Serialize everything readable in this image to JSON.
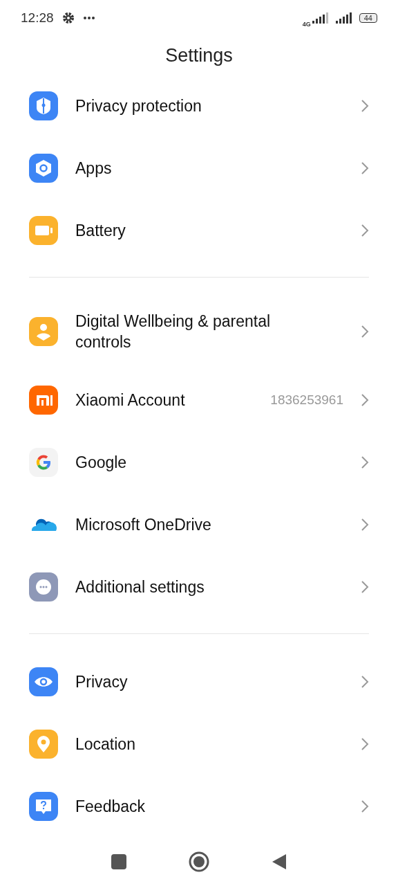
{
  "status_bar": {
    "time": "12:28",
    "network": "4G",
    "battery": "44"
  },
  "title": "Settings",
  "sections": [
    {
      "items": [
        {
          "kind": "shield",
          "label": "Privacy protection"
        },
        {
          "kind": "apps",
          "label": "Apps"
        },
        {
          "kind": "battery",
          "label": "Battery"
        }
      ]
    },
    {
      "items": [
        {
          "kind": "wellbeing",
          "label": "Digital Wellbeing & parental controls"
        },
        {
          "kind": "mi",
          "label": "Xiaomi Account",
          "value": "1836253961"
        },
        {
          "kind": "google",
          "label": "Google"
        },
        {
          "kind": "cloud",
          "label": "Microsoft OneDrive"
        },
        {
          "kind": "more",
          "label": "Additional settings"
        }
      ]
    },
    {
      "items": [
        {
          "kind": "eye",
          "label": "Privacy"
        },
        {
          "kind": "pin",
          "label": "Location"
        },
        {
          "kind": "feedback",
          "label": "Feedback"
        }
      ]
    }
  ]
}
